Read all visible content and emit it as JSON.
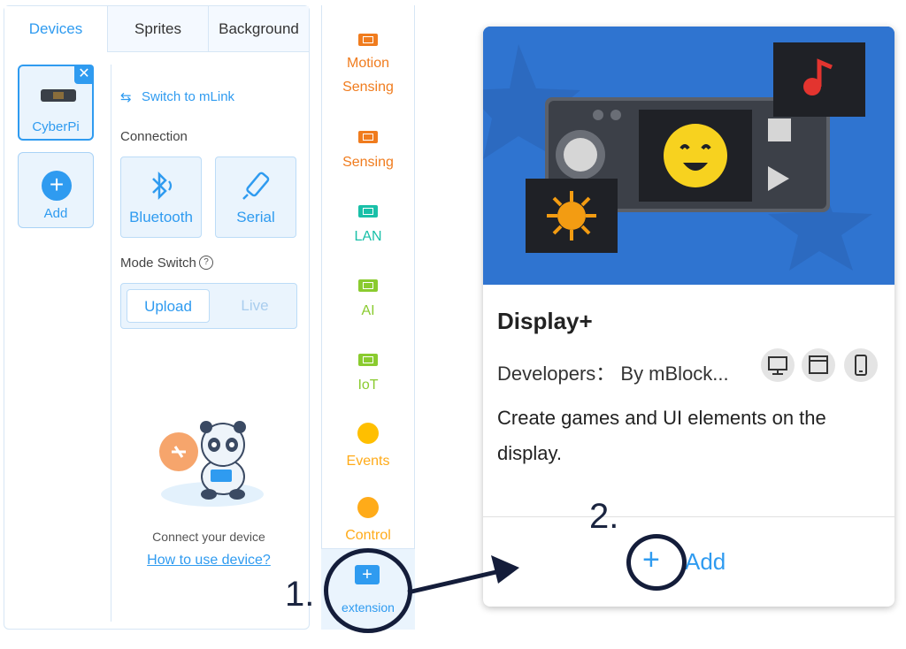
{
  "tabs": [
    "Devices",
    "Sprites",
    "Background"
  ],
  "device_list": {
    "selected_device": "CyberPi",
    "add_label": "Add"
  },
  "device_panel": {
    "switch_link": "Switch to mLink",
    "connection_label": "Connection",
    "bluetooth_label": "Bluetooth",
    "serial_label": "Serial",
    "mode_switch_label": "Mode Switch",
    "upload_label": "Upload",
    "live_label": "Live",
    "connect_hint": "Connect your device",
    "help_link": "How to use device?"
  },
  "categories": [
    {
      "label": "Motion Sensing",
      "color": "#f07c1e"
    },
    {
      "label": "Sensing",
      "color": "#f07c1e"
    },
    {
      "label": "LAN",
      "color": "#19c0a8"
    },
    {
      "label": "AI",
      "color": "#8acb2f"
    },
    {
      "label": "IoT",
      "color": "#8acb2f"
    },
    {
      "label": "Events",
      "color": "#ffbf00"
    },
    {
      "label": "Control",
      "color": "#ffab19"
    }
  ],
  "extension_button": {
    "label": "extension"
  },
  "extension_card": {
    "title": "Display+",
    "developers": "Developers： By mBlock...",
    "description": "Create games and UI elements on the display.",
    "add_label": "Add",
    "platforms": [
      "desktop-icon",
      "browser-icon",
      "mobile-icon"
    ]
  },
  "annotations": {
    "step1": "1.",
    "step2": "2."
  },
  "colors": {
    "accent": "#2f9bf0",
    "annotation": "#141d3a",
    "banner": "#2f74d0"
  }
}
